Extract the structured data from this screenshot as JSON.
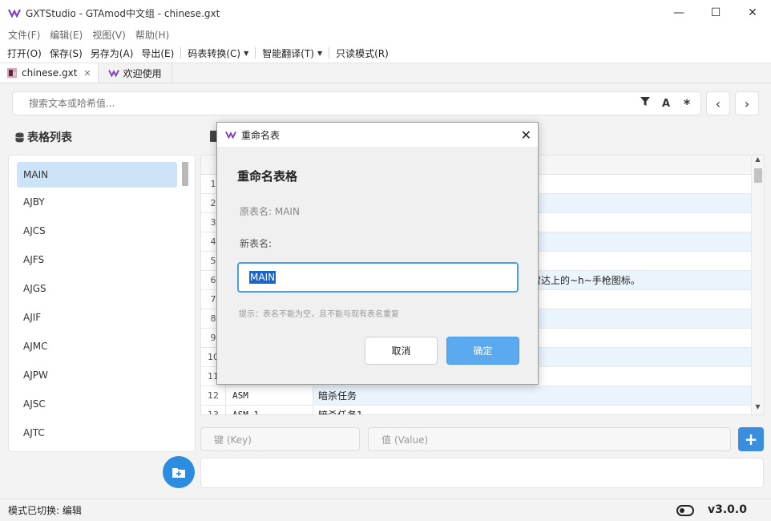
{
  "window": {
    "title": "GXTStudio - GTAmod中文组 - chinese.gxt",
    "minimize": "—",
    "maximize": "☐",
    "close": "✕"
  },
  "menu": [
    "文件(F)",
    "编辑(E)",
    "视图(V)",
    "帮助(H)"
  ],
  "toolbar": {
    "open": "打开(O)",
    "save": "保存(S)",
    "save_as": "另存为(A)",
    "export": "导出(E)",
    "codemap": "码表转换(C)",
    "translate": "智能翻译(T)",
    "readonly": "只读模式(R)"
  },
  "tabs": [
    {
      "label": "chinese.gxt",
      "close": "✕"
    },
    {
      "label": "欢迎使用"
    }
  ],
  "search": {
    "placeholder": "搜索文本或哈希值..."
  },
  "sidebar": {
    "title": "表格列表",
    "items": [
      "MAIN",
      "AJBY",
      "AJCS",
      "AJFS",
      "AJGS",
      "AJIF",
      "AJMC",
      "AJPW",
      "AJSC",
      "AJTC"
    ]
  },
  "table": {
    "rows": [
      {
        "n": "1",
        "key": "",
        "value": ""
      },
      {
        "n": "2",
        "key": "",
        "value": ""
      },
      {
        "n": "3",
        "key": "",
        "value": ""
      },
      {
        "n": "4",
        "key": "",
        "value": ""
      },
      {
        "n": "5",
        "key": "",
        "value": ""
      },
      {
        "n": "6",
        "key": "",
        "value": "雷达上的~h~手枪图标。"
      },
      {
        "n": "7",
        "key": "",
        "value": ""
      },
      {
        "n": "8",
        "key": "",
        "value": ""
      },
      {
        "n": "9",
        "key": "",
        "value": ""
      },
      {
        "n": "10",
        "key": "",
        "value": ""
      },
      {
        "n": "11",
        "key": "",
        "value": ""
      },
      {
        "n": "12",
        "key": "ASM",
        "value": "暗杀任务"
      },
      {
        "n": "13",
        "key": "ASM_1",
        "value": "暗杀任务1"
      }
    ]
  },
  "editor": {
    "key_placeholder": "键 (Key)",
    "value_placeholder": "值 (Value)",
    "add": "+"
  },
  "status": {
    "text": "模式已切换: 编辑",
    "version": "v3.0.0"
  },
  "dialog": {
    "title": "重命名表",
    "heading": "重命名表格",
    "original": "原表名: MAIN",
    "new_label": "新表名:",
    "value": "MAIN",
    "hint": "提示：表名不能为空，且不能与现有表名重复",
    "cancel": "取消",
    "ok": "确定",
    "close": "✕"
  }
}
